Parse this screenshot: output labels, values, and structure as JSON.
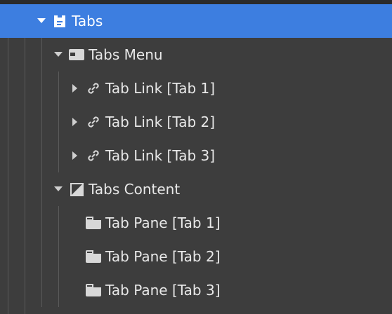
{
  "navigator": {
    "items": [
      {
        "label": "Tabs",
        "icon": "tabs-icon",
        "expanded": true,
        "selected": true
      },
      {
        "label": "Tabs Menu",
        "icon": "tabs-menu-icon",
        "expanded": true
      },
      {
        "label": "Tab Link [Tab 1]",
        "icon": "link-icon",
        "expanded": false
      },
      {
        "label": "Tab Link [Tab 2]",
        "icon": "link-icon",
        "expanded": false
      },
      {
        "label": "Tab Link [Tab 3]",
        "icon": "link-icon",
        "expanded": false
      },
      {
        "label": "Tabs Content",
        "icon": "tabs-content-icon",
        "expanded": true
      },
      {
        "label": "Tab Pane [Tab 1]",
        "icon": "tab-pane-icon"
      },
      {
        "label": "Tab Pane [Tab 2]",
        "icon": "tab-pane-icon"
      },
      {
        "label": "Tab Pane [Tab 3]",
        "icon": "tab-pane-icon"
      }
    ]
  },
  "colors": {
    "background": "#3d3d3d",
    "selected": "#3d7ee0",
    "text": "#e8e8e8"
  }
}
